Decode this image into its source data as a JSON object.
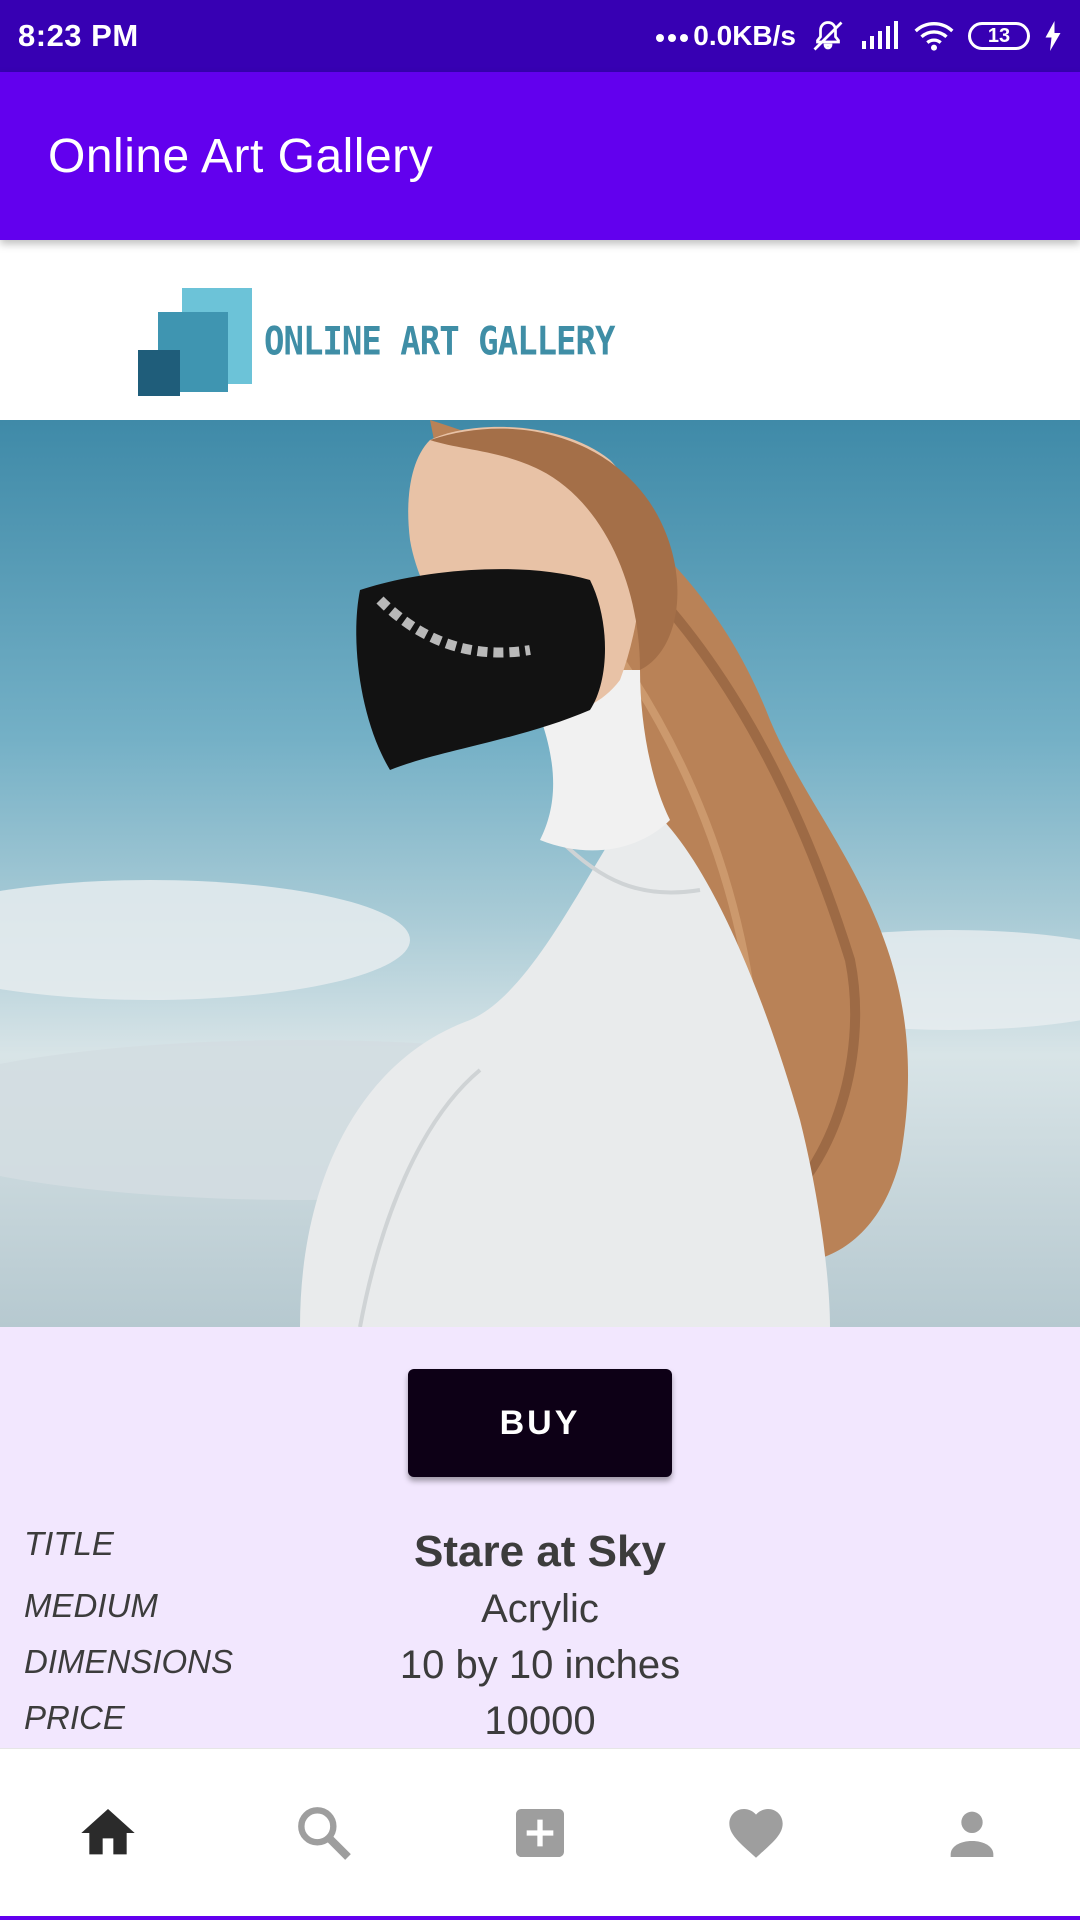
{
  "status_bar": {
    "time": "8:23 PM",
    "network_speed": "0.0KB/s",
    "battery_level": "13",
    "icons": [
      "more-dots-icon",
      "mute-bell-icon",
      "signal-icon",
      "wifi-icon",
      "battery-icon",
      "charging-icon"
    ]
  },
  "app_bar": {
    "title": "Online Art Gallery"
  },
  "logo": {
    "text": "ONLINE ART GALLERY"
  },
  "artwork": {
    "buy_label": "BUY",
    "labels": {
      "title": "TITLE",
      "medium": "MEDIUM",
      "dimensions": "DIMENSIONS",
      "price": "PRICE"
    },
    "values": {
      "title": "Stare at Sky",
      "medium": "Acrylic",
      "dimensions": "10 by 10 inches",
      "price": "10000"
    }
  },
  "bottom_nav": {
    "items": [
      {
        "icon": "home-icon",
        "active": true
      },
      {
        "icon": "search-icon",
        "active": false
      },
      {
        "icon": "add-box-icon",
        "active": false
      },
      {
        "icon": "heart-icon",
        "active": false
      },
      {
        "icon": "person-icon",
        "active": false
      }
    ]
  },
  "colors": {
    "status_bar": "#3700b3",
    "app_bar": "#6200ee",
    "details_bg": "#f2e7fe",
    "buy_button": "#0d0016",
    "nav_active": "#2b2b2b",
    "nav_inactive": "#9e9e9e"
  }
}
